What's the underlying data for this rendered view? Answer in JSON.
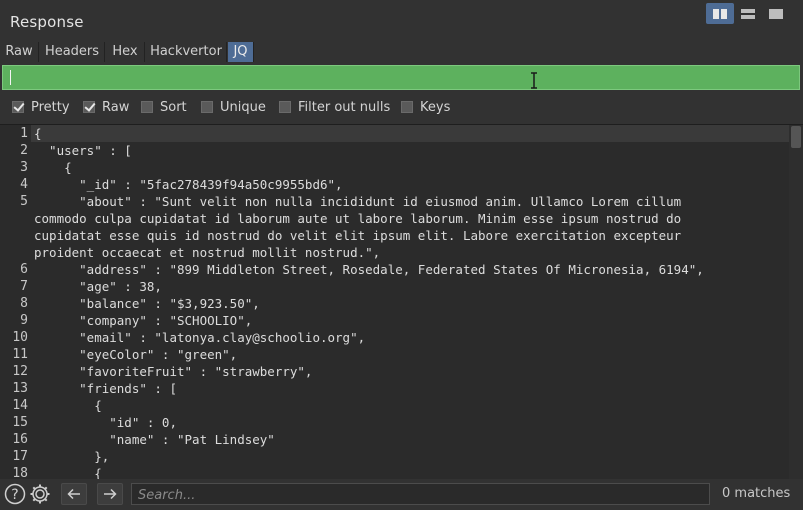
{
  "header": {
    "title": "Response"
  },
  "view_buttons": [
    {
      "icon": "split-columns-icon",
      "active": true
    },
    {
      "icon": "split-rows-icon",
      "active": false
    },
    {
      "icon": "single-pane-icon",
      "active": false
    }
  ],
  "tabs": [
    {
      "label": "Raw",
      "active": false
    },
    {
      "label": "Headers",
      "active": false
    },
    {
      "label": "Hex",
      "active": false
    },
    {
      "label": "Hackvertor",
      "active": false
    },
    {
      "label": "JQ",
      "active": true
    }
  ],
  "jq_filter": {
    "value": ""
  },
  "options": [
    {
      "label": "Pretty",
      "checked": true
    },
    {
      "label": "Raw",
      "checked": true
    },
    {
      "label": "Sort",
      "checked": false
    },
    {
      "label": "Unique",
      "checked": false
    },
    {
      "label": "Filter out nulls",
      "checked": false
    },
    {
      "label": "Keys",
      "checked": false
    }
  ],
  "editor": {
    "lines": [
      {
        "n": "1",
        "text": [
          "{"
        ]
      },
      {
        "n": "2",
        "text": [
          "  \"users\" : ["
        ]
      },
      {
        "n": "3",
        "text": [
          "    {"
        ]
      },
      {
        "n": "4",
        "text": [
          "      \"_id\" : \"5fac278439f94a50c9955bd6\","
        ]
      },
      {
        "n": "5",
        "text": [
          "      \"about\" : \"Sunt velit non nulla incididunt id eiusmod anim. Ullamco Lorem cillum",
          "commodo culpa cupidatat id laborum aute ut labore laborum. Minim esse ipsum nostrud do",
          "cupidatat esse quis id nostrud do velit elit ipsum elit. Labore exercitation excepteur",
          "proident occaecat et nostrud mollit nostrud.\","
        ]
      },
      {
        "n": "6",
        "text": [
          "      \"address\" : \"899 Middleton Street, Rosedale, Federated States Of Micronesia, 6194\","
        ]
      },
      {
        "n": "7",
        "text": [
          "      \"age\" : 38,"
        ]
      },
      {
        "n": "8",
        "text": [
          "      \"balance\" : \"$3,923.50\","
        ]
      },
      {
        "n": "9",
        "text": [
          "      \"company\" : \"SCHOOLIO\","
        ]
      },
      {
        "n": "10",
        "text": [
          "      \"email\" : \"latonya.clay@schoolio.org\","
        ]
      },
      {
        "n": "11",
        "text": [
          "      \"eyeColor\" : \"green\","
        ]
      },
      {
        "n": "12",
        "text": [
          "      \"favoriteFruit\" : \"strawberry\","
        ]
      },
      {
        "n": "13",
        "text": [
          "      \"friends\" : ["
        ]
      },
      {
        "n": "14",
        "text": [
          "        {"
        ]
      },
      {
        "n": "15",
        "text": [
          "          \"id\" : 0,"
        ]
      },
      {
        "n": "16",
        "text": [
          "          \"name\" : \"Pat Lindsey\""
        ]
      },
      {
        "n": "17",
        "text": [
          "        },"
        ]
      },
      {
        "n": "18",
        "text": [
          "        {"
        ]
      }
    ]
  },
  "footer": {
    "search_placeholder": "Search...",
    "matches": "0 matches"
  },
  "colors": {
    "accent": "#4e6c95",
    "jq_bar": "#5db15e",
    "background": "#323232",
    "editor_bg": "#2b2b2b"
  }
}
